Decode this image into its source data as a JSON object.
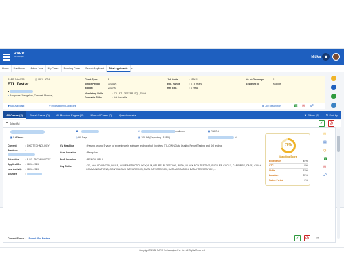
{
  "header": {
    "logo_title": "RARR",
    "logo_subtitle": "Technologies",
    "user_name": "Nitika"
  },
  "nav_tabs": [
    {
      "label": "Home"
    },
    {
      "label": "Dashboard"
    },
    {
      "label": "Active Jobs"
    },
    {
      "label": "My Cases"
    },
    {
      "label": "Running Cases"
    },
    {
      "label": "Search Applicant"
    },
    {
      "label": "Total Applicants"
    },
    {
      "label": "x"
    }
  ],
  "job": {
    "id_label": "RARR Job 4716",
    "date": "08-11-2024",
    "title": "ETL Tester",
    "location": "Bangalore / Bengaluru, Chennai, Mumbai, ...",
    "client_spoc_label": "Client Spoc",
    "client_spoc": ": F",
    "notice_label": "Notice Period",
    "notice": ": 30 Days",
    "budget_label": "Budget",
    "budget": ": 23 LPA",
    "job_code_label": "Job Code",
    "job_code": ": 655611",
    "exp_range_label": "Exp. Range",
    "exp_range": ": 3 - 8 Years",
    "rel_exp_label": "Rel. Exp.",
    "rel_exp": ": 4 Years",
    "openings_label": "No. of Openings",
    "openings": ": 1",
    "assigned_label": "Assigned To",
    "assigned": ": Multiple",
    "mandatory_label": "Mandatory Skills",
    "mandatory": ": ETL, ETL TESTER, SQL, DWH",
    "desirable_label": "Desirable Skills",
    "desirable": ": Not Available",
    "add_applicant": "Add Applicant",
    "find_matching": "Find Matching Applicant",
    "job_description": "Job Description"
  },
  "filter_tabs": [
    {
      "label": "All Cases (4)"
    },
    {
      "label": "Portal Cases (0)"
    },
    {
      "label": "AI Machine Engine (0)"
    },
    {
      "label": "Manual Cases (0)"
    },
    {
      "label": "Questionnaire"
    }
  ],
  "filters_label": "Filters (6)",
  "sort_label": "Sort by",
  "select_all": "Select All",
  "candidate": {
    "experience": "5.6 Years",
    "notice": "90 Days",
    "ctc": "10 LPA (Expecting 15 LPA)",
    "email_suffix": "mail.com",
    "phone_prefix": "+",
    "h_prefix": "H",
    "rarr_id": "RARR-I",
    "current_label": "Current",
    "current": ": DXC TECHNOLOGY",
    "previous_label": "Previous",
    "previous": ":",
    "education_label": "Education",
    "education": ": B.SC. TECHNOLOGY...",
    "applied_label": "Applied On",
    "applied": ": 08-11-2024",
    "last_activity_label": "Last Activity",
    "last_activity": ": 08-11-2024",
    "sourcer_label": "Sourcer",
    "sourcer": ":",
    "cv_headline_label": "CV Headline",
    "cv_headline": ": Having around 5 years of experience in software testing which involves ETL/DWH/Data Quality, Report Testing and DQ testing.",
    "cur_location_label": "Curr. Location",
    "cur_location": ": Bengaluru",
    "pref_location_label": "Pref. Location",
    "pref_location": ": BENGALURU",
    "key_skills_label": "Key Skills",
    "key_skills": ": 27, A++, ADVANCED, AGILE, AGILE METHODOLOGY, ALM, AZURE, BI TESTING, BRTH, BLACK BOX TESTING, BUG LIFE CYCLE, CARRIERS, CASE, CCM+, COMMUNICATIONS, CONTINUOUS INTEGRATION, DATA INTEGRATION, DATA MIGRATION, DATA PREPARATION,...",
    "current_status_label": "Current Status :",
    "current_status": "Submit For Review"
  },
  "matching": {
    "score_text": "70%",
    "score_value": 70,
    "label": "Matching Score",
    "rows": [
      {
        "name": "Experience",
        "value": "45%",
        "pct": 45
      },
      {
        "name": "CTC",
        "value": "9%",
        "pct": 9
      },
      {
        "name": "Skills",
        "value": "67%",
        "pct": 67
      },
      {
        "name": "Location",
        "value": "95%",
        "pct": 95
      },
      {
        "name": "Notice Period",
        "value": "0%",
        "pct": 0
      }
    ]
  },
  "footer": "Copyright © 2021 RARR Technologies Pvt. Ltd. All Rights Reserved",
  "colors": {
    "primary": "#1e5fbf",
    "accent_gold": "#f0b429",
    "success": "#2e9a3e",
    "danger": "#cc2222"
  }
}
